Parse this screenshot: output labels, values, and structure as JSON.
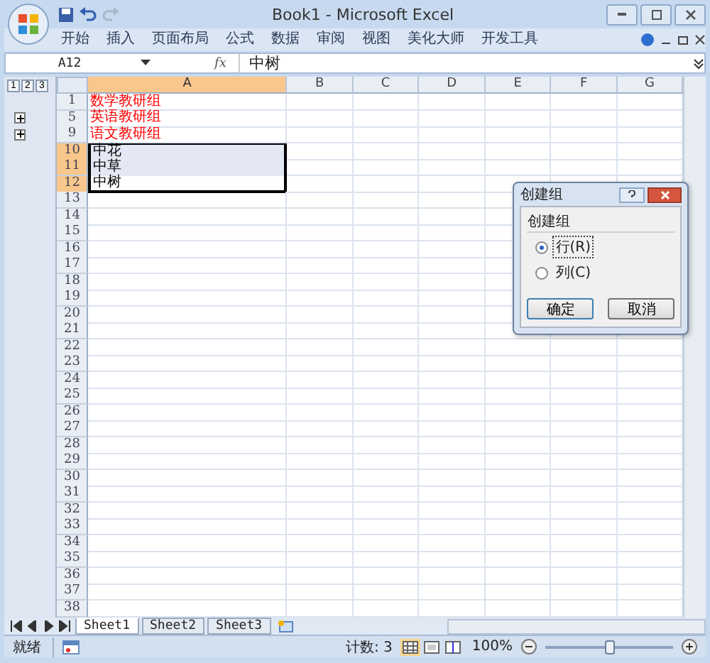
{
  "window": {
    "title": "Book1 - Microsoft Excel"
  },
  "ribbon_tabs": [
    {
      "label": "开始"
    },
    {
      "label": "插入"
    },
    {
      "label": "页面布局"
    },
    {
      "label": "公式"
    },
    {
      "label": "数据"
    },
    {
      "label": "审阅"
    },
    {
      "label": "视图"
    },
    {
      "label": "美化大师"
    },
    {
      "label": "开发工具"
    }
  ],
  "formula_bar": {
    "name_box": "A12",
    "function_label": "fx",
    "formula": "中树"
  },
  "outline_levels": [
    "1",
    "2",
    "3"
  ],
  "columns": [
    {
      "label": "A",
      "selected": true
    },
    {
      "label": "B",
      "selected": false
    },
    {
      "label": "C",
      "selected": false
    },
    {
      "label": "D",
      "selected": false
    },
    {
      "label": "E",
      "selected": false
    },
    {
      "label": "F",
      "selected": false
    },
    {
      "label": "G",
      "selected": false
    }
  ],
  "rows": [
    {
      "number": "1",
      "text": "数学教研组",
      "color": "#ff0000",
      "selected": false,
      "active": false,
      "collapsed": false
    },
    {
      "number": "5",
      "text": "英语教研组",
      "color": "#ff0000",
      "selected": false,
      "active": false,
      "collapsed": true
    },
    {
      "number": "9",
      "text": "语文教研组",
      "color": "#ff0000",
      "selected": false,
      "active": false,
      "collapsed": true
    },
    {
      "number": "10",
      "text": "中花",
      "color": "#000000",
      "selected": true,
      "active": false,
      "collapsed": false
    },
    {
      "number": "11",
      "text": "中草",
      "color": "#000000",
      "selected": true,
      "active": false,
      "collapsed": false
    },
    {
      "number": "12",
      "text": "中树",
      "color": "#000000",
      "selected": true,
      "active": true,
      "collapsed": false
    },
    {
      "number": "13"
    },
    {
      "number": "14"
    },
    {
      "number": "15"
    },
    {
      "number": "16"
    },
    {
      "number": "17"
    },
    {
      "number": "18"
    },
    {
      "number": "19"
    },
    {
      "number": "20"
    },
    {
      "number": "21"
    },
    {
      "number": "22"
    },
    {
      "number": "23"
    },
    {
      "number": "24"
    },
    {
      "number": "25"
    },
    {
      "number": "26"
    },
    {
      "number": "27"
    },
    {
      "number": "28"
    },
    {
      "number": "29"
    },
    {
      "number": "30"
    },
    {
      "number": "31"
    },
    {
      "number": "32"
    },
    {
      "number": "33"
    },
    {
      "number": "34"
    },
    {
      "number": "35"
    },
    {
      "number": "36"
    },
    {
      "number": "37"
    },
    {
      "number": "38"
    }
  ],
  "dialog": {
    "title": "创建组",
    "group_label": "创建组",
    "options": [
      {
        "label": "行(R)",
        "selected": true
      },
      {
        "label": "列(C)",
        "selected": false
      }
    ],
    "buttons": [
      "确定",
      "取消"
    ]
  },
  "sheet_tabs": [
    {
      "label": "Sheet1",
      "selected": true
    },
    {
      "label": "Sheet2",
      "selected": false
    },
    {
      "label": "Sheet3",
      "selected": false
    }
  ],
  "status_bar": {
    "mode": "就绪",
    "count": "计数: 3",
    "zoom": "100%",
    "zoom_slider": {
      "level": 0.5
    }
  }
}
